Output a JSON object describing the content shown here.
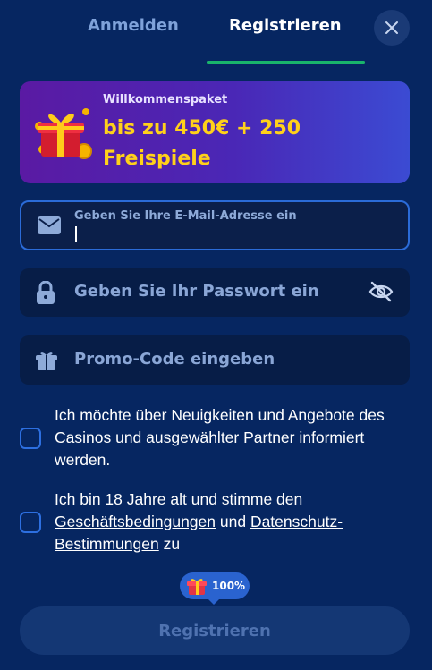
{
  "tabs": {
    "login_label": "Anmelden",
    "register_label": "Registrieren"
  },
  "banner": {
    "kicker": "Willkommenspaket",
    "title": "bis zu 450€ + 250 Freispiele"
  },
  "form": {
    "email_label": "Geben Sie Ihre E-Mail-Adresse ein",
    "password_placeholder": "Geben Sie Ihr Passwort ein",
    "promo_placeholder": "Promo-Code eingeben"
  },
  "consent": {
    "newsletter_text": "Ich möchte über Neuigkeiten und Angebote des Casinos und ausgewählter Partner informiert werden.",
    "terms_prefix": "Ich bin 18 Jahre alt und stimme den ",
    "terms_link": "Geschäftsbedingungen",
    "terms_middle": " und ",
    "privacy_link": "Datenschutz-Bestimmungen",
    "terms_suffix": " zu"
  },
  "progress_badge": {
    "text": "100%",
    "value": 100
  },
  "submit_label": "Registrieren",
  "icons": {
    "close": "close-icon",
    "gift_box": "gift-icon",
    "email": "mail-icon",
    "lock": "lock-icon",
    "eye_off": "eye-off-icon",
    "promo": "gift-icon"
  },
  "colors": {
    "background": "#062661",
    "accent_green": "#19b46b",
    "bonus_yellow": "#ffd11a",
    "input_focus": "#2b6bd8",
    "checkbox_border": "#2d6fe0"
  }
}
